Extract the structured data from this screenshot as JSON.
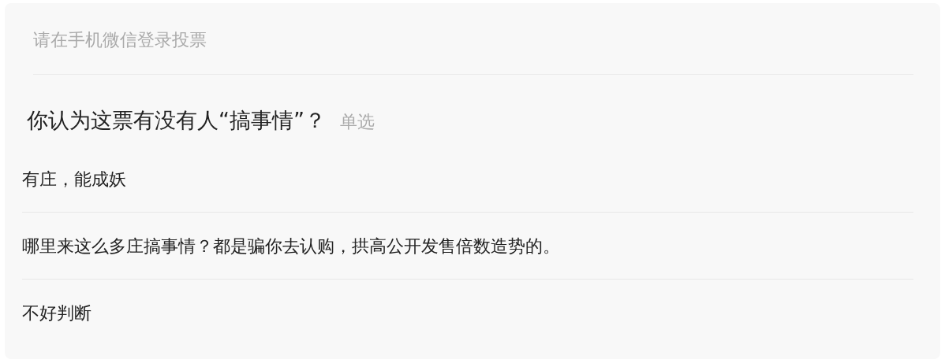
{
  "notice": "请在手机微信登录投票",
  "question": {
    "text": "你认为这票有没有人“搞事情”？",
    "type_label": "单选"
  },
  "options": [
    {
      "label": "有庄，能成妖"
    },
    {
      "label": "哪里来这么多庄搞事情？都是骗你去认购，拱高公开发售倍数造势的。"
    },
    {
      "label": "不好判断"
    }
  ]
}
